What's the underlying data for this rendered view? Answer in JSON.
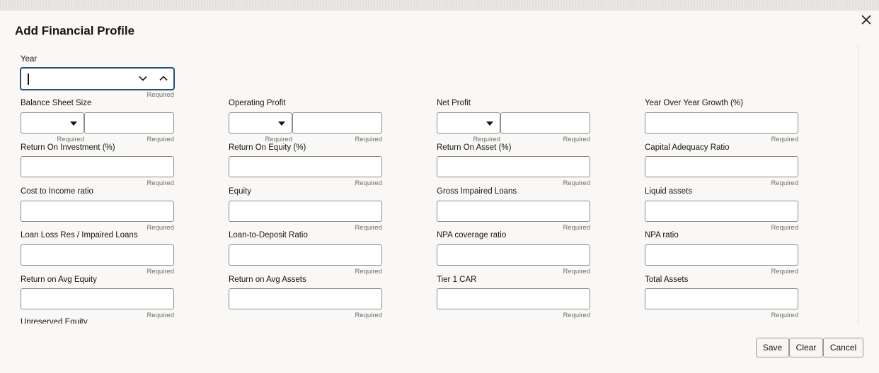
{
  "dialog": {
    "title": "Add Financial Profile"
  },
  "year": {
    "label": "Year",
    "value": "",
    "required": "Required"
  },
  "required_text": "Required",
  "fields": {
    "balance_sheet_size": "Balance Sheet Size",
    "operating_profit": "Operating Profit",
    "net_profit": "Net Profit",
    "yoy_growth": "Year Over Year Growth (%)",
    "roi": "Return On Investment (%)",
    "roe": "Return On Equity (%)",
    "roa": "Return On Asset (%)",
    "car": "Capital Adequacy Ratio",
    "cost_income": "Cost to Income ratio",
    "equity": "Equity",
    "gross_impaired_loans": "Gross Impaired Loans",
    "liquid_assets": "Liquid assets",
    "loan_loss_res": "Loan Loss Res / Impaired Loans",
    "loan_deposit": "Loan-to-Deposit Ratio",
    "npa_coverage": "NPA coverage ratio",
    "npa_ratio": "NPA ratio",
    "roae": "Return on Avg Equity",
    "roaa": "Return on Avg Assets",
    "tier1_car": "Tier 1 CAR",
    "total_assets": "Total Assets",
    "unreserved_equity": "Unreserved Equity"
  },
  "buttons": {
    "save": "Save",
    "clear": "Clear",
    "cancel": "Cancel"
  },
  "icons": {
    "close": "close-icon",
    "year_down": "chevron-down-icon",
    "year_up": "chevron-up-icon",
    "dropdown": "caret-down-icon"
  },
  "colors": {
    "background": "#f9f8f6",
    "focus_border": "#25507a",
    "input_border": "#8f8c88",
    "hint_text": "#6f6c68"
  }
}
